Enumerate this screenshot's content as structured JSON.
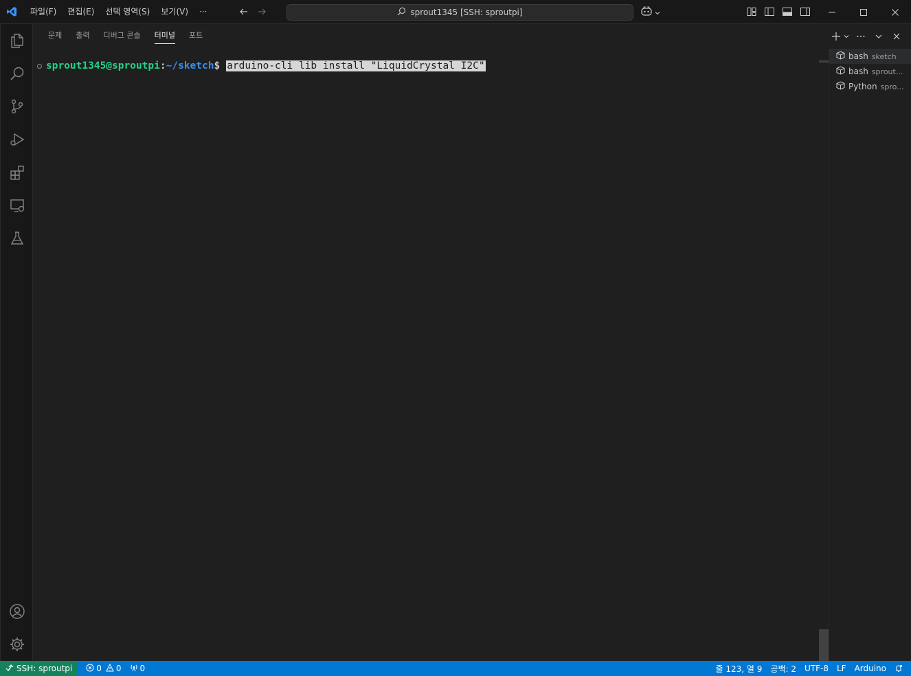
{
  "titlebar": {
    "menu": [
      "파일(F)",
      "편집(E)",
      "선택 영역(S)",
      "보기(V)",
      "···"
    ],
    "search_text": "sprout1345 [SSH: sproutpi]"
  },
  "panel": {
    "tabs": [
      "문제",
      "출력",
      "디버그 콘솔",
      "터미널",
      "포트"
    ],
    "active_tab": "터미널"
  },
  "terminal": {
    "user_host": "sprout1345@sproutpi",
    "colon": ":",
    "path": "~/sketch",
    "dollar": "$",
    "command": "arduino-cli lib install \"LiquidCrystal I2C\""
  },
  "terminal_list": [
    {
      "name": "bash",
      "desc": "sketch"
    },
    {
      "name": "bash",
      "desc": "sprout..."
    },
    {
      "name": "Python",
      "desc": "spro..."
    }
  ],
  "statusbar": {
    "remote": "SSH: sproutpi",
    "errors": "0",
    "warnings": "0",
    "ports": "0",
    "position": "줄 123, 열 9",
    "spaces": "공백: 2",
    "encoding": "UTF-8",
    "eol": "LF",
    "language": "Arduino"
  },
  "colors": {
    "accent": "#0078d4",
    "remote": "#16825d",
    "prompt_user": "#23d18b",
    "prompt_path": "#3b8eea"
  }
}
